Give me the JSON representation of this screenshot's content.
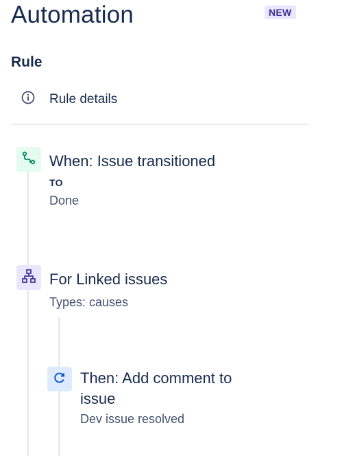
{
  "header": {
    "title": "Automation",
    "badge": "NEW"
  },
  "rule": {
    "heading": "Rule",
    "details_label": "Rule details"
  },
  "steps": [
    {
      "title": "When: Issue transitioned",
      "caption": "TO",
      "subtitle": "Done",
      "icon": "trigger-branch-icon",
      "icon_bg": "#e3fcef",
      "icon_color": "#00875a"
    },
    {
      "title": "For Linked issues",
      "subtitle": "Types: causes",
      "icon": "hierarchy-icon",
      "icon_bg": "#eae6ff",
      "icon_color": "#403294"
    },
    {
      "title_line1": "Then: Add comment to",
      "title_line2": "issue",
      "subtitle": "Dev issue resolved",
      "icon": "refresh-action-icon",
      "icon_bg": "#deebff",
      "icon_color": "#0052cc"
    }
  ]
}
